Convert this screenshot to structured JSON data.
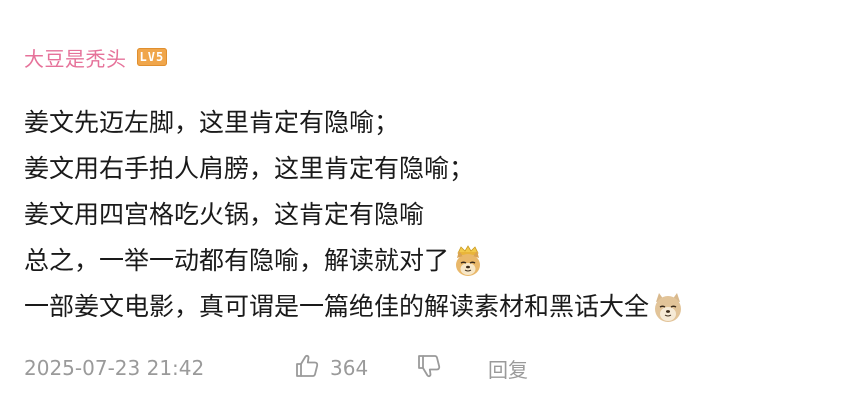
{
  "comment": {
    "username": "大豆是秃头",
    "level_badge": "LV5",
    "lines": [
      "姜文先迈左脚，这里肯定有隐喻；",
      "姜文用右手拍人肩膀，这里肯定有隐喻；",
      "姜文用四宫格吃火锅，这肯定有隐喻",
      "总之，一举一动都有隐喻，解读就对了",
      "一部姜文电影，真可谓是一篇绝佳的解读素材和黑话大全"
    ],
    "emojis": [
      "doge-king-emoji",
      "doge-emoji"
    ],
    "timestamp": "2025-07-23 21:42",
    "like_count": "364",
    "reply_label": "回复"
  },
  "colors": {
    "username": "#e6729a",
    "badge": "#f0a64b",
    "text": "#1a1a1a",
    "meta": "#9a9a9a"
  }
}
